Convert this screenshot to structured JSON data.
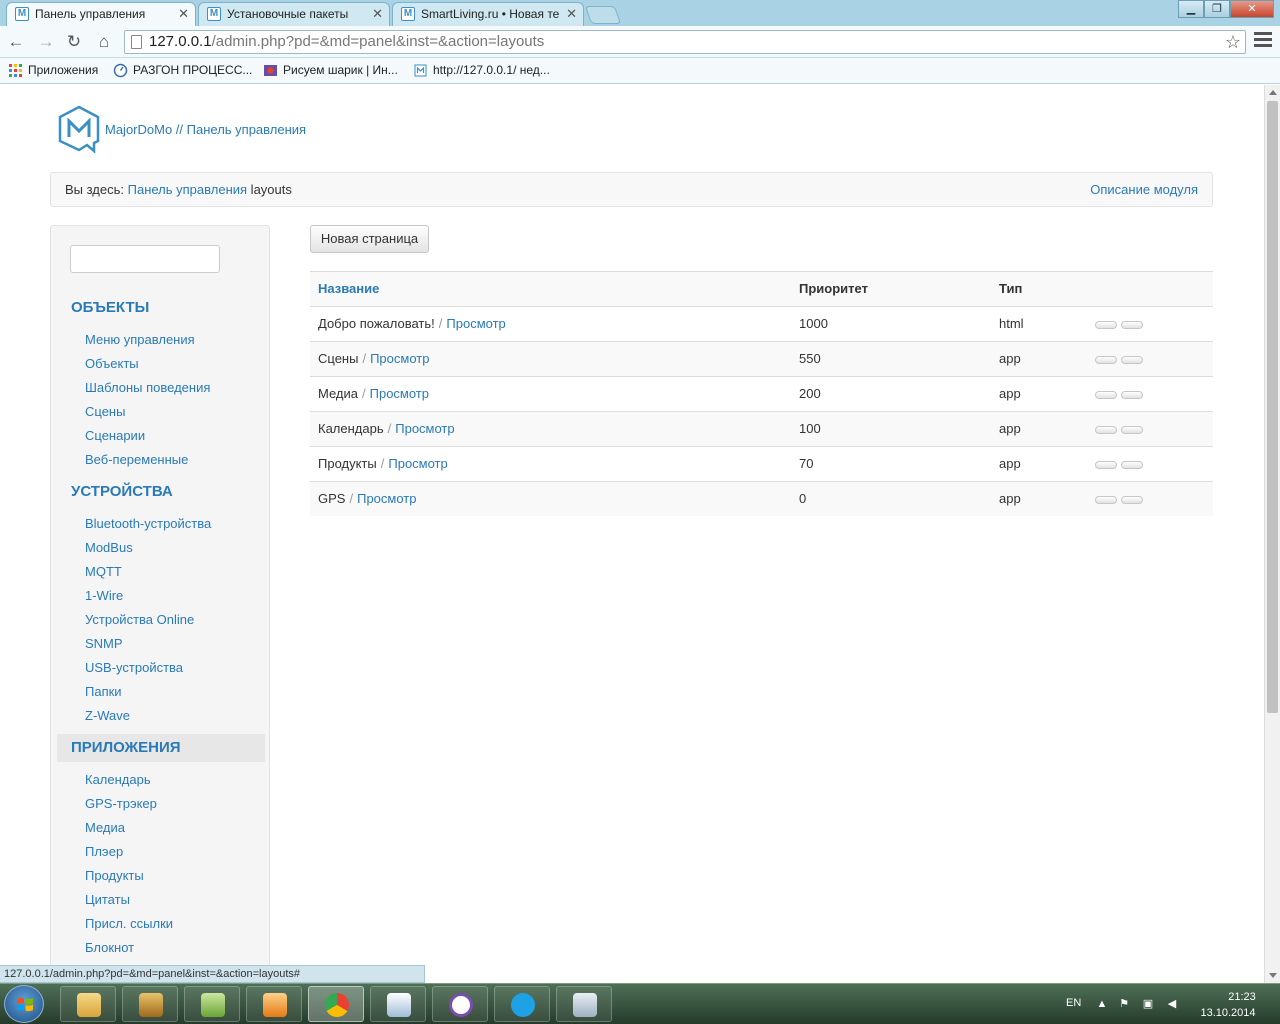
{
  "browser": {
    "tabs": [
      {
        "label": "Панель управления",
        "favicon": "M"
      },
      {
        "label": "Установочные пакеты",
        "favicon": "M"
      },
      {
        "label": "SmartLiving.ru • Новая те",
        "favicon": "M"
      }
    ],
    "url_host": "127.0.0.1",
    "url_path": "/admin.php?pd=&md=panel&inst=&action=layouts",
    "bookmarks": [
      {
        "label": "Приложения",
        "icon": "apps-grid-icon"
      },
      {
        "label": "РАЗГОН ПРОЦЕСС...",
        "icon": "speed-icon"
      },
      {
        "label": "Рисуем шарик | Ин...",
        "icon": "film-icon"
      },
      {
        "label": "http://127.0.0.1/ нед...",
        "icon": "majordomo-icon"
      }
    ],
    "window_buttons": {
      "minimize": "▁",
      "restore": "❐",
      "close": "✕"
    }
  },
  "header": {
    "logo_letter": "M",
    "brand": "MajorDoMo",
    "brand_sep": " // ",
    "brand_link": "Панель управления"
  },
  "breadcrumb": {
    "prefix": "Вы здесь: ",
    "link": "Панель управления",
    "current": " layouts",
    "module_help": "Описание модуля"
  },
  "sidebar": {
    "search_value": "",
    "sections": [
      {
        "title": "ОБЪЕКТЫ",
        "items": [
          "Меню управления",
          "Объекты",
          "Шаблоны поведения",
          "Сцены",
          "Сценарии",
          "Веб-переменные"
        ]
      },
      {
        "title": "УСТРОЙСТВА",
        "items": [
          "Bluetooth-устройства",
          "ModBus",
          "MQTT",
          "1-Wire",
          "Устройства Online",
          "SNMP",
          "USB-устройства",
          "Папки",
          "Z-Wave"
        ]
      },
      {
        "title": "ПРИЛОЖЕНИЯ",
        "items": [
          "Календарь",
          "GPS-трэкер",
          "Медиа",
          "Плэер",
          "Продукты",
          "Цитаты",
          "Присл. ссылки",
          "Блокнот"
        ]
      }
    ]
  },
  "main": {
    "new_page_label": "Новая страница",
    "columns": {
      "name": "Название",
      "priority": "Приоритет",
      "type": "Тип"
    },
    "view_label": "Просмотр",
    "separator": "/",
    "rows": [
      {
        "name": "Добро пожаловать!",
        "priority": "1000",
        "type": "html"
      },
      {
        "name": "Сцены",
        "priority": "550",
        "type": "app"
      },
      {
        "name": "Медиа",
        "priority": "200",
        "type": "app"
      },
      {
        "name": "Календарь",
        "priority": "100",
        "type": "app"
      },
      {
        "name": "Продукты",
        "priority": "70",
        "type": "app"
      },
      {
        "name": "GPS",
        "priority": "0",
        "type": "app"
      }
    ]
  },
  "statusbar": {
    "text": "127.0.0.1/admin.php?pd=&md=panel&inst=&action=layouts#"
  },
  "taskbar": {
    "apps": [
      "explorer-icon",
      "archive-icon",
      "notepadpp-icon",
      "media-player-icon",
      "chrome-icon",
      "presentation-icon",
      "circle-app-icon",
      "skype-icon",
      "paint-icon"
    ],
    "language": "EN",
    "time": "21:23",
    "date": "13.10.2014"
  },
  "colors": {
    "link": "#2a7ab8",
    "chrome": "#a9d3e4",
    "taskbar": "#2f4a35"
  }
}
